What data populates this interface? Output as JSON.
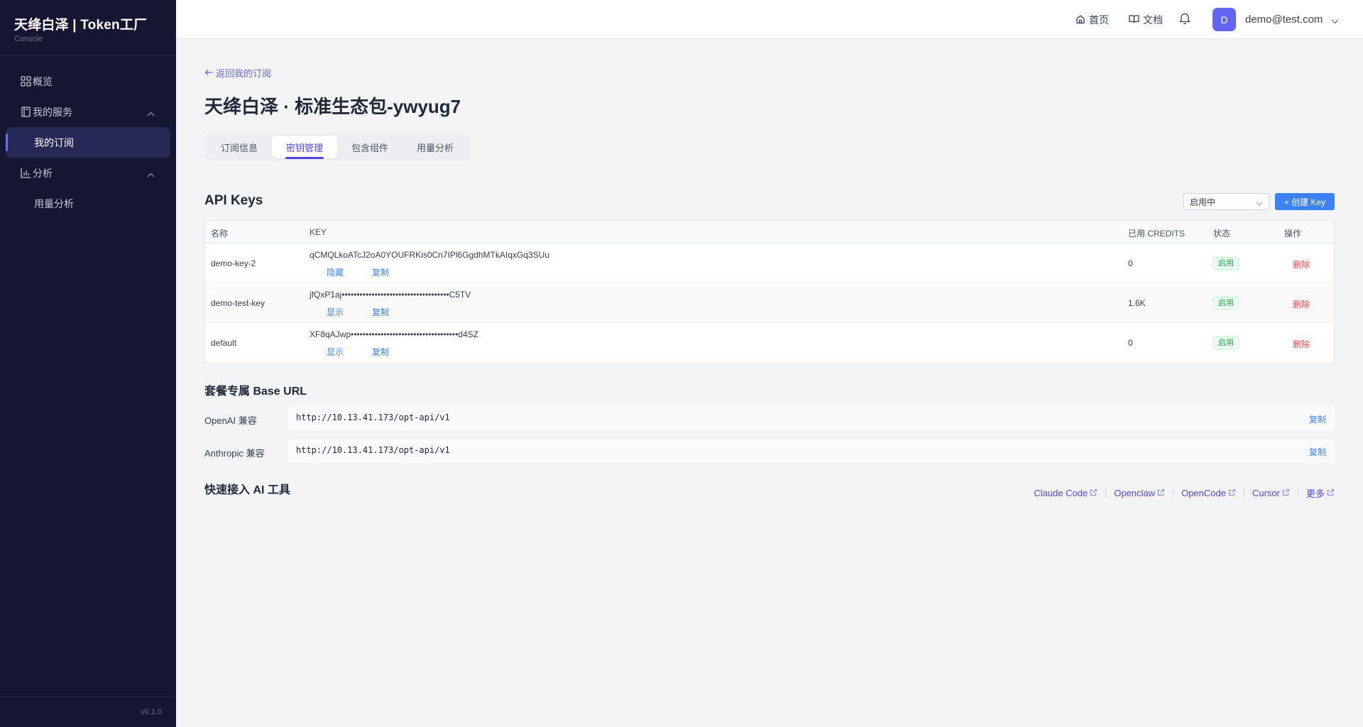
{
  "sidebar": {
    "brand_title": "天绛白泽 | Token工厂",
    "brand_sub": "Console",
    "items": [
      {
        "label": "概览",
        "icon": "grid-icon"
      },
      {
        "label": "我的服务",
        "icon": "book-icon"
      },
      {
        "label": "我的订阅"
      },
      {
        "label": "分析",
        "icon": "bar-chart-icon"
      },
      {
        "label": "用量分析"
      }
    ],
    "version": "v0.1.0"
  },
  "topbar": {
    "home_label": "首页",
    "docs_label": "文档",
    "avatar_letter": "D",
    "user_email": "demo@test.com"
  },
  "main": {
    "back_label": "返回我的订阅",
    "page_title": "天绛白泽 · 标准生态包-ywyug7",
    "tabs": [
      "订阅信息",
      "密钥管理",
      "包含组件",
      "用量分析"
    ],
    "active_tab": "密钥管理"
  },
  "api_keys": {
    "title": "API Keys",
    "filter_value": "启用中",
    "create_label": "+ 创建 Key",
    "columns": [
      "名称",
      "KEY",
      "已用 CREDITS",
      "状态",
      "操作"
    ],
    "rows": [
      {
        "name": "demo-key-2",
        "key": "qCMQLkoATcJ2oA0YOUFRKis0Cn7IPl6GgdhMTkAIqxGq3SUu",
        "toggle": "隐藏",
        "copy": "复制",
        "credits": "0",
        "status": "启用",
        "action": "删除"
      },
      {
        "name": "demo-test-key",
        "key": "jfQxP1aj••••••••••••••••••••••••••••••••••••C5TV",
        "toggle": "显示",
        "copy": "复制",
        "credits": "1.6K",
        "status": "启用",
        "action": "删除"
      },
      {
        "name": "default",
        "key": "XF8qAJwp••••••••••••••••••••••••••••••••••••d4SZ",
        "toggle": "显示",
        "copy": "复制",
        "credits": "0",
        "status": "启用",
        "action": "删除"
      }
    ]
  },
  "base_url": {
    "title": "套餐专属 Base URL",
    "rows": [
      {
        "label": "OpenAI 兼容",
        "value": "http://10.13.41.173/opt-api/v1",
        "copy": "复制"
      },
      {
        "label": "Anthropic 兼容",
        "value": "http://10.13.41.173/opt-api/v1",
        "copy": "复制"
      }
    ]
  },
  "quick_access": {
    "title": "快速接入 AI 工具",
    "tools": [
      "Claude Code",
      "Openclaw",
      "OpenCode",
      "Cursor",
      "更多"
    ]
  },
  "colors": {
    "sidebar_bg": "#141632",
    "accent": "#4f46e5",
    "primary_button": "#3b82f6",
    "success": "#16a34a",
    "danger": "#ef4444"
  }
}
